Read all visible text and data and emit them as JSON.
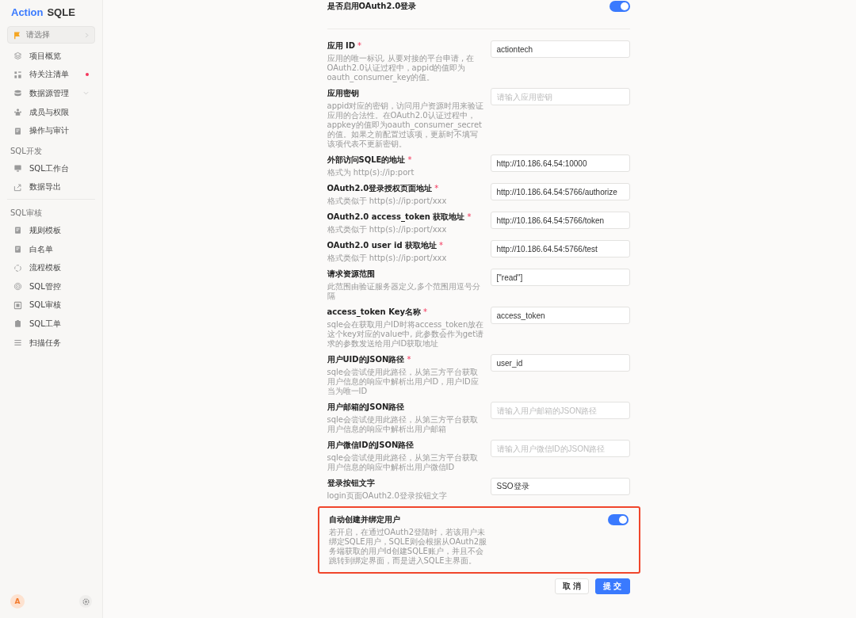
{
  "sidebar": {
    "logo": {
      "brand": "Action",
      "product": "SQLE"
    },
    "project_select": {
      "placeholder": "请选择"
    },
    "groups": [
      {
        "items": [
          {
            "label": "项目概览",
            "dot": false,
            "expandable": false
          },
          {
            "label": "待关注清单",
            "dot": true,
            "expandable": false
          },
          {
            "label": "数据源管理",
            "dot": false,
            "expandable": true
          },
          {
            "label": "成员与权限",
            "dot": false,
            "expandable": false
          },
          {
            "label": "操作与审计",
            "dot": false,
            "expandable": false
          }
        ]
      },
      {
        "heading": "SQL开发",
        "items": [
          {
            "label": "SQL工作台",
            "dot": false,
            "expandable": false
          },
          {
            "label": "数据导出",
            "dot": false,
            "expandable": false
          }
        ]
      },
      {
        "heading": "SQL审核",
        "items": [
          {
            "label": "规则模板",
            "dot": false,
            "expandable": false
          },
          {
            "label": "白名单",
            "dot": false,
            "expandable": false
          },
          {
            "label": "流程模板",
            "dot": false,
            "expandable": false
          },
          {
            "label": "SQL管控",
            "dot": false,
            "expandable": false
          },
          {
            "label": "SQL审核",
            "dot": false,
            "expandable": false
          },
          {
            "label": "SQL工单",
            "dot": false,
            "expandable": false
          },
          {
            "label": "扫描任务",
            "dot": false,
            "expandable": false
          }
        ]
      }
    ],
    "avatar": "A"
  },
  "oauth_toggle": {
    "label": "是否启用OAuth2.0登录",
    "on": true
  },
  "fields": [
    {
      "label": "应用 ID",
      "required_mark": "*",
      "description": "应用的唯一标识, 从要对接的平台申请 , 在OAuth2.0认证过程中，appid的值即为oauth_consumer_key的值。",
      "value": "actiontech"
    },
    {
      "label": "应用密钥",
      "description": "appid对应的密钥，访问用户资源时用来验证应用的合法性。在OAuth2.0认证过程中，appkey的值即为oauth_consumer_secret的值。如果之前配置过该项，更新时不填写该项代表不更新密钥。",
      "placeholder": "请输入应用密钥"
    },
    {
      "label": "外部访问SQLE的地址",
      "required_mark": "*",
      "description": "格式为 http(s)://ip:port",
      "value": "http://10.186.64.54:10000"
    },
    {
      "label": "OAuth2.0登录授权页面地址",
      "required_mark": "*",
      "description": "格式类似于 http(s)://ip:port/xxx",
      "value": "http://10.186.64.54:5766/authorize"
    },
    {
      "label": "OAuth2.0 access_token 获取地址",
      "required_mark": "*",
      "description": "格式类似于 http(s)://ip:port/xxx",
      "value": "http://10.186.64.54:5766/token"
    },
    {
      "label": "OAuth2.0 user id 获取地址",
      "required_mark": "*",
      "description": "格式类似于 http(s)://ip:port/xxx",
      "value": "http://10.186.64.54:5766/test"
    },
    {
      "label": "请求资源范围",
      "description": "此范围由验证服务器定义,多个范围用逗号分隔",
      "value": "[\"read\"]"
    },
    {
      "label": "access_token Key名称",
      "required_mark": "*",
      "description": "sqle会在获取用户ID时将access_token放在这个key对应的value中, 此参数会作为get请求的参数发送给用户ID获取地址",
      "value": "access_token"
    },
    {
      "label": "用户UID的JSON路径",
      "required_mark": "*",
      "description": "sqle会尝试使用此路径，从第三方平台获取用户信息的响应中解析出用户ID，用户ID应当为唯一ID",
      "value": "user_id"
    },
    {
      "label": "用户邮箱的JSON路径",
      "description": "sqle会尝试使用此路径，从第三方平台获取用户信息的响应中解析出用户邮箱",
      "placeholder": "请输入用户邮箱的JSON路径"
    },
    {
      "label": "用户微信ID的JSON路径",
      "description": "sqle会尝试使用此路径，从第三方平台获取用户信息的响应中解析出用户微信ID",
      "placeholder": "请输入用户微信ID的JSON路径"
    },
    {
      "label": "登录按钮文字",
      "description": "login页面OAuth2.0登录按钮文字",
      "value": "SSO登录"
    }
  ],
  "auto_bind": {
    "label": "自动创建并绑定用户",
    "description": "若开启，在通过OAuth2登陆时，若该用户未绑定SQLE用户，SQLE则会根据从OAuth2服务端获取的用户Id创建SQLE账户，并且不会跳转到绑定界面，而是进入SQLE主界面。",
    "on": true,
    "highlighted": true
  },
  "buttons": [
    {
      "label": "取 消",
      "kind": "default"
    },
    {
      "label": "提 交",
      "kind": "primary"
    }
  ]
}
